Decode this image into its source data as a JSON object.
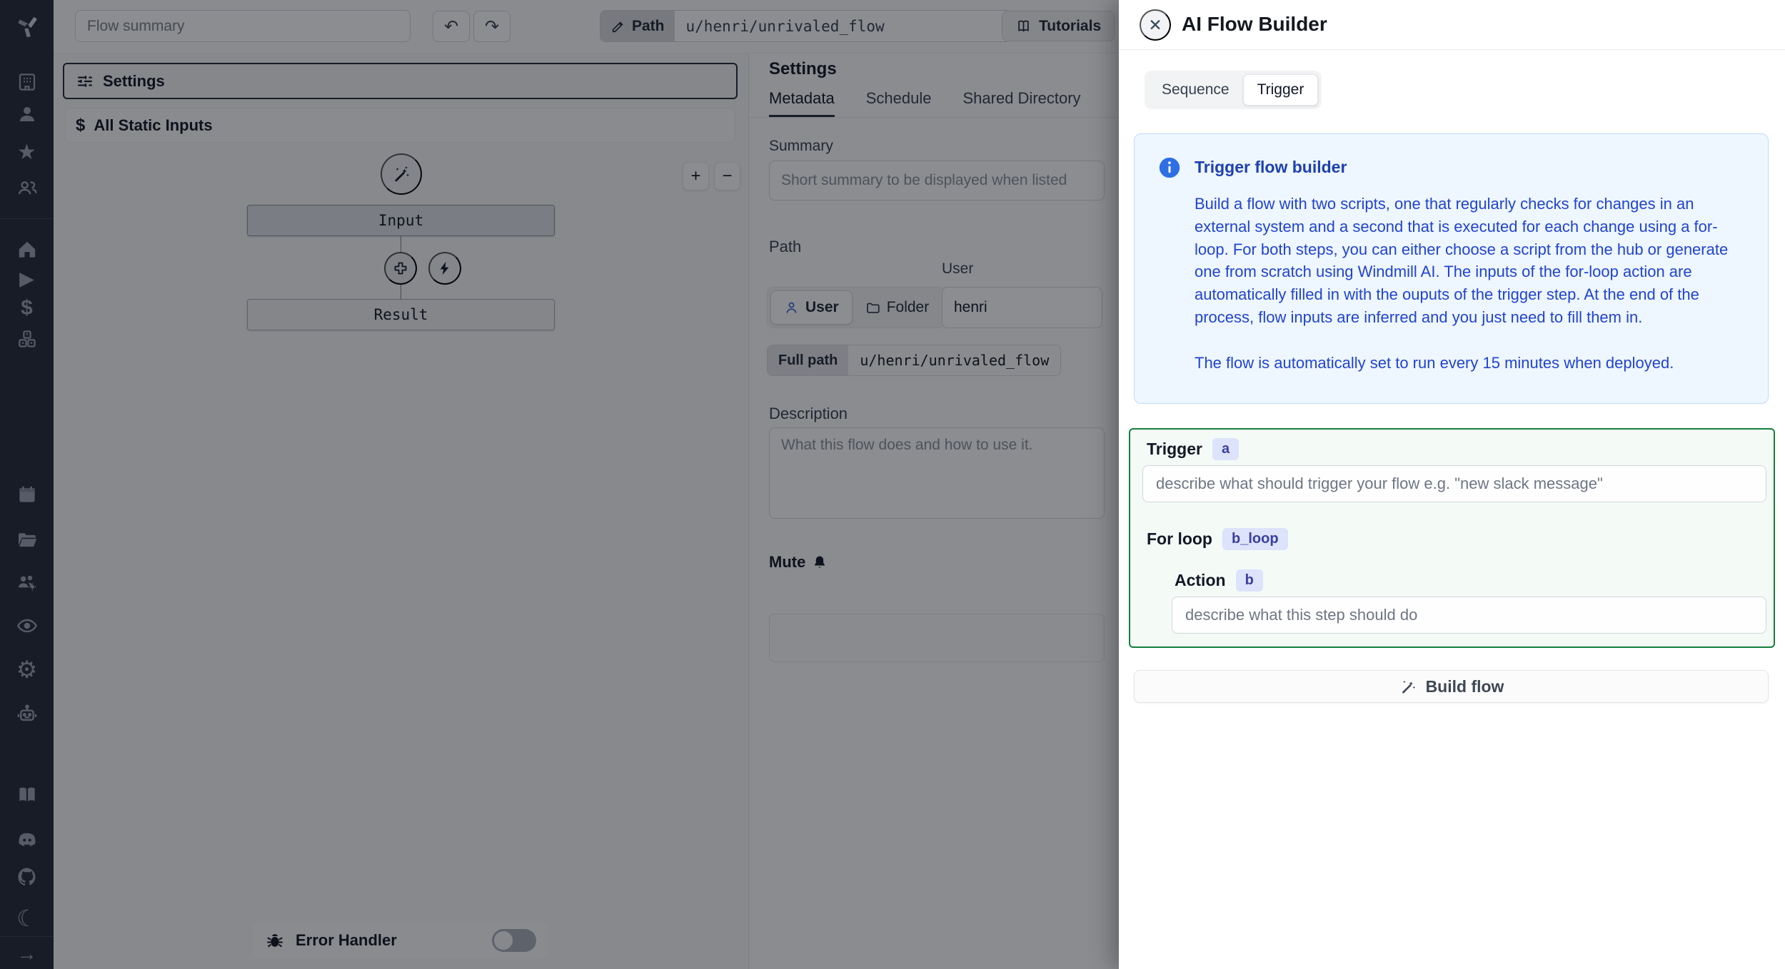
{
  "icons": {
    "close": "✕",
    "undo": "↶",
    "redo": "↷",
    "zoom_in": "+",
    "zoom_out": "−",
    "plus": "+",
    "dollar": "$",
    "star": "★",
    "play": "▶",
    "gear": "⚙",
    "moon": "☾",
    "expand": "→"
  },
  "topbar": {
    "flow_summary_placeholder": "Flow summary",
    "path_label": "Path",
    "path_value": "u/henri/unrivaled_flow",
    "tutorials_label": "Tutorials"
  },
  "flow_editor": {
    "settings_button": "Settings",
    "all_static_inputs": "All Static Inputs",
    "input_node": "Input",
    "result_node": "Result",
    "error_handler": "Error Handler"
  },
  "settings_panel": {
    "title": "Settings",
    "tabs": [
      "Metadata",
      "Schedule",
      "Shared Directory"
    ],
    "summary_label": "Summary",
    "summary_placeholder": "Short summary to be displayed when listed",
    "path_label": "Path",
    "user_field_label": "User",
    "user_field_value": "henri",
    "owner_user": "User",
    "owner_folder": "Folder",
    "full_path_label": "Full path",
    "full_path_value": "u/henri/unrivaled_flow",
    "description_label": "Description",
    "description_placeholder": "What this flow does and how to use it.",
    "mute_label": "Mute"
  },
  "drawer": {
    "title": "AI Flow Builder",
    "tab_sequence": "Sequence",
    "tab_trigger": "Trigger",
    "info_title": "Trigger flow builder",
    "info_body": "Build a flow with two scripts, one that regularly checks for changes in an external system and a second that is executed for each change using a for-loop. For both steps, you can either choose a script from the hub or generate one from scratch using Windmill AI. The inputs of the for-loop action are automatically filled in with the ouputs of the trigger step. At the end of the process, flow inputs are inferred and you just need to fill them in.",
    "info_footer": "The flow is automatically set to run every 15 minutes when deployed.",
    "trigger_label": "Trigger",
    "trigger_badge": "a",
    "trigger_placeholder": "describe what should trigger your flow e.g. \"new slack message\"",
    "forloop_label": "For loop",
    "forloop_badge": "b_loop",
    "action_label": "Action",
    "action_badge": "b",
    "action_placeholder": "describe what this step should do",
    "build_button": "Build flow"
  },
  "colors": {
    "info_text": "#2144cd",
    "info_bg": "#eef6ff",
    "trigger_border_green": "#15803d",
    "badge_bg": "#dde3fa",
    "badge_text": "#3b3f9e",
    "sidebar_bg": "#222a3a"
  }
}
